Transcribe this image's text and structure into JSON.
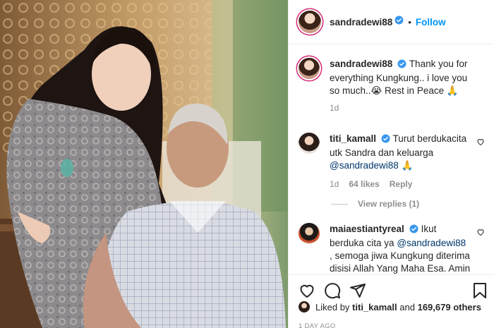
{
  "post": {
    "author": "sandradewi88",
    "follow_label": "Follow",
    "separator": "•"
  },
  "caption": {
    "username": "sandradewi88",
    "text": "Thank you for everything Kungkung.. i love you so much..😭 Rest in Peace 🙏",
    "time": "1d"
  },
  "comments": [
    {
      "username": "titi_kamall",
      "text_before": "Turut berdukacita utk Sandra dan keluarga",
      "mention": "@sandradewi88",
      "text_after": "🙏",
      "time": "1d",
      "likes": "64 likes",
      "reply_label": "Reply",
      "view_replies": "View replies (1)"
    },
    {
      "username": "maiaestiantyreal",
      "text_before": "Ikut berduka cita ya",
      "mention": "@sandradewi88",
      "text_after": ", semoga jiwa Kungkung diterima disisi Allah Yang Maha Esa. Amin"
    }
  ],
  "likes_line": {
    "prefix": "Liked by",
    "liker": "titi_kamall",
    "conjunction": "and",
    "others": "169,679 others"
  },
  "time_ago": "1 DAY AGO",
  "icons": {
    "verified": "verified-badge-icon",
    "heart": "heart-icon",
    "comment": "comment-icon",
    "share": "paper-plane-icon",
    "save": "bookmark-icon"
  },
  "colors": {
    "accent": "#0095f6",
    "verified": "#3897f0",
    "mention": "#00376b",
    "muted": "#8e8e8e",
    "text": "#262626"
  }
}
